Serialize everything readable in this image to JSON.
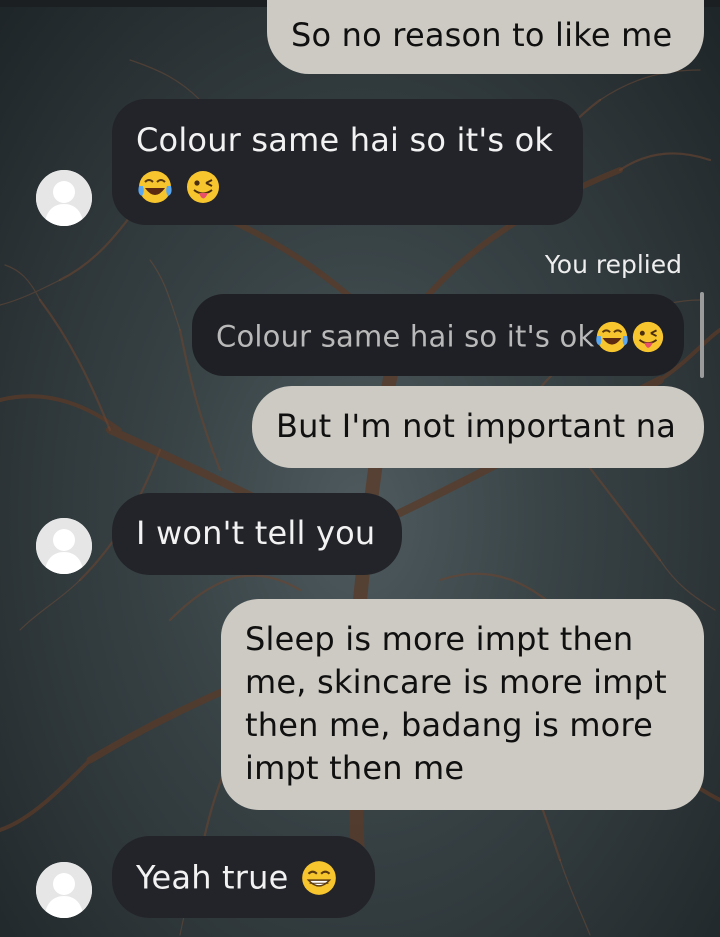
{
  "messages": [
    {
      "id": "m1",
      "direction": "outgoing",
      "text": "So no reason to like me"
    },
    {
      "id": "m2",
      "direction": "incoming",
      "text": "Colour same hai so it's ok",
      "emoji": [
        "face-with-tears-of-joy",
        "winking-face-with-tongue"
      ]
    },
    {
      "id": "m3",
      "direction": "outgoing",
      "reply_label": "You replied",
      "quoted_text": "Colour same hai so it's ok",
      "quoted_emoji": [
        "face-with-tears-of-joy",
        "winking-face-with-tongue"
      ],
      "text": "But I'm not important na"
    },
    {
      "id": "m4",
      "direction": "incoming",
      "text": "I won't tell you"
    },
    {
      "id": "m5",
      "direction": "outgoing",
      "lines": [
        "Sleep is more impt then",
        "me, skincare is more impt",
        "then me, badang is more",
        "impt then me"
      ]
    },
    {
      "id": "m6",
      "direction": "incoming",
      "text": "Yeah true",
      "emoji": [
        "beaming-face-with-smiling-eyes"
      ]
    }
  ],
  "colors": {
    "incoming_bubble": "#232429",
    "outgoing_bubble": "#cdcac3",
    "quote_bubble": "#1f2025",
    "avatar_placeholder": "#e6e6e6"
  }
}
